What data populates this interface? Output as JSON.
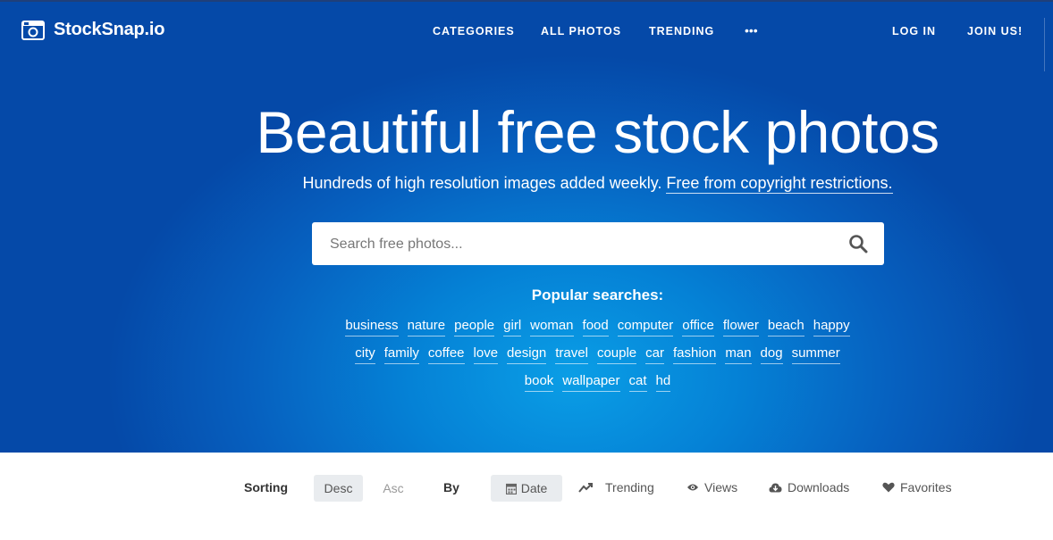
{
  "app": {
    "logo_text": "StockSnap.io"
  },
  "nav": {
    "categories": "CATEGORIES",
    "all_photos": "ALL PHOTOS",
    "trending": "TRENDING",
    "more": "•••",
    "login": "LOG IN",
    "join": "JOIN US!"
  },
  "hero": {
    "headline": "Beautiful free stock photos",
    "sub_text": "Hundreds of high resolution images added weekly.",
    "sub_link": "Free from copyright restrictions."
  },
  "search": {
    "placeholder": "Search free photos..."
  },
  "popular": {
    "heading": "Popular searches:",
    "rows": [
      [
        "business",
        "nature",
        "people",
        "girl",
        "woman",
        "food",
        "computer",
        "office",
        "flower",
        "beach",
        "happy"
      ],
      [
        "city",
        "family",
        "coffee",
        "love",
        "design",
        "travel",
        "couple",
        "car",
        "fashion",
        "man",
        "dog",
        "summer"
      ],
      [
        "book",
        "wallpaper",
        "cat",
        "hd"
      ]
    ]
  },
  "sorting": {
    "label": "Sorting",
    "desc": "Desc",
    "asc": "Asc",
    "by_label": "By",
    "options": {
      "date": "Date",
      "trending": "Trending",
      "views": "Views",
      "downloads": "Downloads",
      "favorites": "Favorites"
    }
  },
  "colors": {
    "hero_dark": "#0549a8",
    "hero_light": "#0a9ee6",
    "pill_bg": "#e9ecef"
  }
}
